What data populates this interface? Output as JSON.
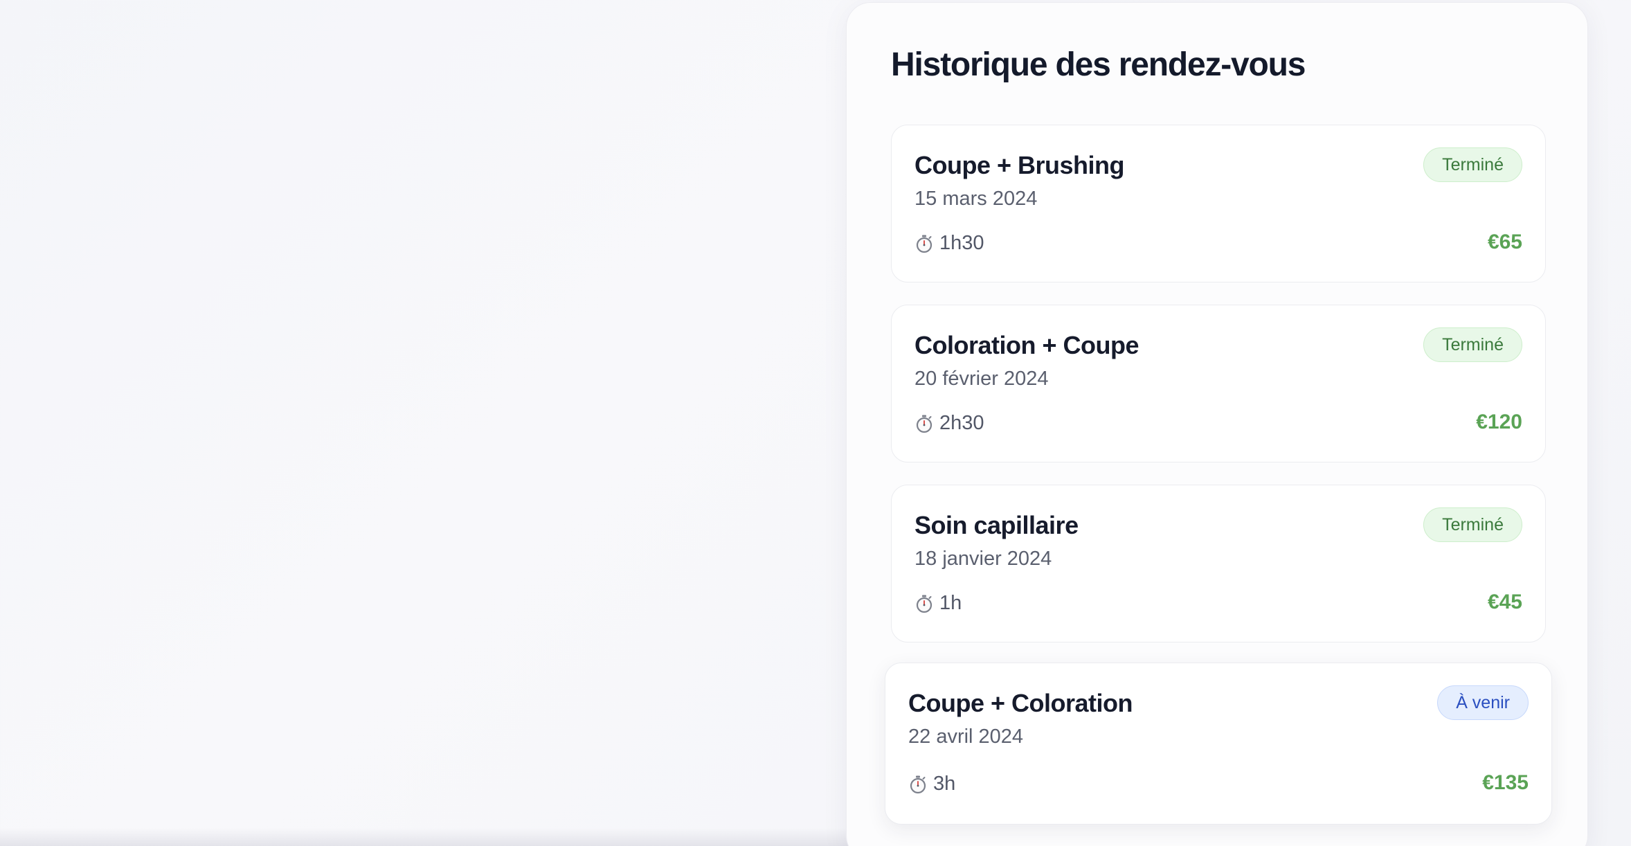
{
  "history": {
    "title": "Historique des rendez-vous",
    "appointments": [
      {
        "service": "Coupe + Brushing",
        "date": "15 mars 2024",
        "duration_icon": "stopwatch-icon",
        "duration": "1h30",
        "price": "€65",
        "status": "Terminé"
      },
      {
        "service": "Coloration + Coupe",
        "date": "20 février 2024",
        "duration_icon": "stopwatch-icon",
        "duration": "2h30",
        "price": "€120",
        "status": "Terminé"
      },
      {
        "service": "Soin capillaire",
        "date": "18 janvier 2024",
        "duration_icon": "stopwatch-icon",
        "duration": "1h",
        "price": "€45",
        "status": "Terminé"
      },
      {
        "service": "Coupe + Coloration",
        "date": "22 avril 2024",
        "duration_icon": "stopwatch-icon",
        "duration": "3h",
        "price": "€135",
        "status": "À venir"
      }
    ]
  },
  "colors": {
    "price": "#5aa355",
    "status_done_bg": "#e8f8e8",
    "status_done_text": "#3b7a3c",
    "status_upcoming_bg": "#e5eefe",
    "status_upcoming_text": "#2a4fc0"
  }
}
